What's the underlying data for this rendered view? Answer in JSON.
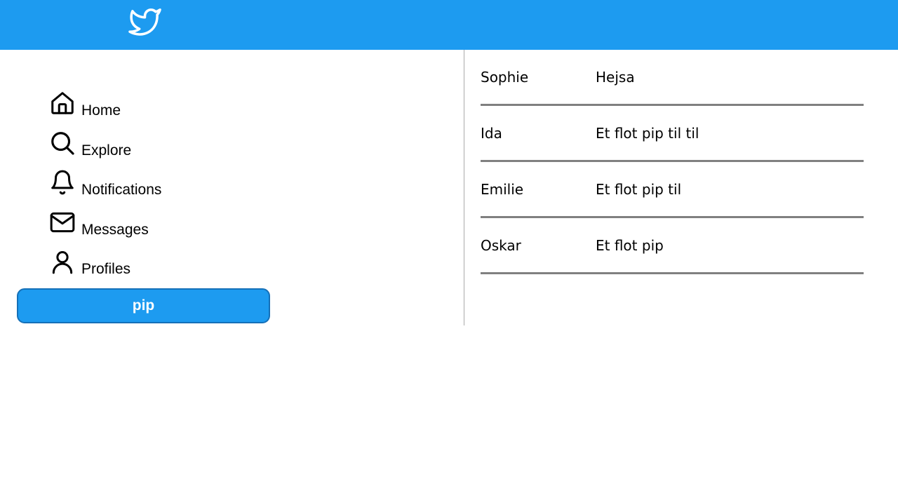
{
  "header": {
    "logo_icon": "twitter-bird-icon",
    "background_color": "#1d9bf0"
  },
  "sidebar": {
    "items": [
      {
        "label": "Home",
        "icon": "home-icon"
      },
      {
        "label": "Explore",
        "icon": "search-icon"
      },
      {
        "label": "Notifications",
        "icon": "bell-icon"
      },
      {
        "label": "Messages",
        "icon": "envelope-icon"
      },
      {
        "label": "Profiles",
        "icon": "user-icon"
      }
    ],
    "post_button_label": "pip"
  },
  "feed": {
    "posts": [
      {
        "author": "Sophie",
        "message": "Hejsa"
      },
      {
        "author": "Ida",
        "message": "Et flot pip til til"
      },
      {
        "author": "Emilie",
        "message": "Et flot pip til"
      },
      {
        "author": "Oskar",
        "message": "Et flot pip"
      }
    ]
  }
}
